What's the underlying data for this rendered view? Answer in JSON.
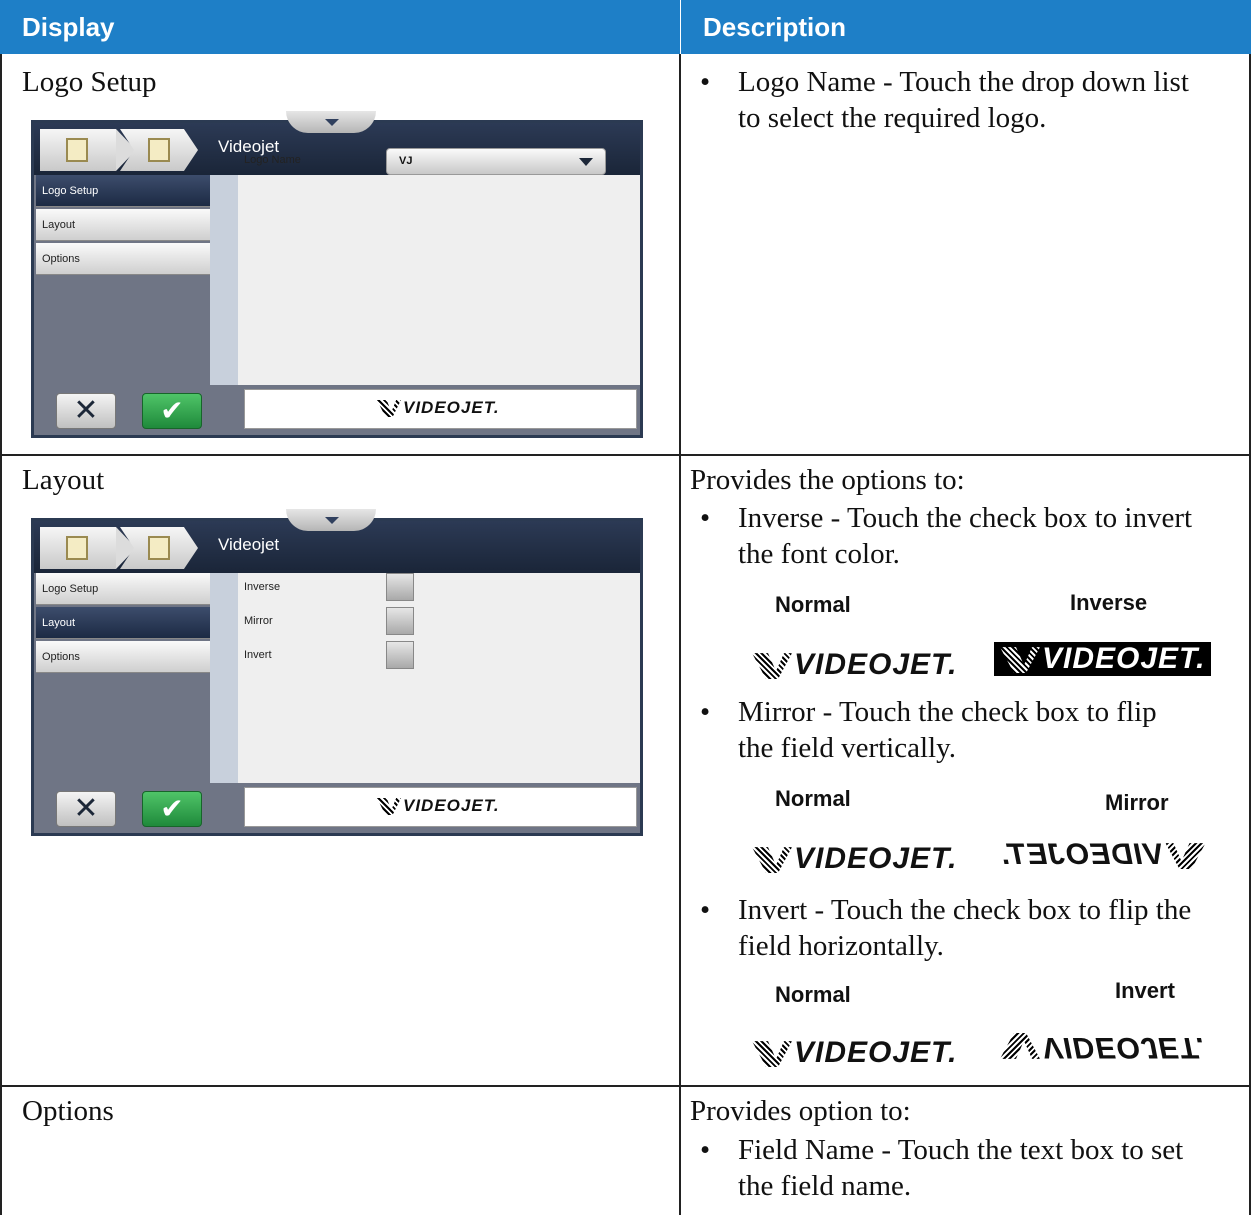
{
  "table": {
    "header_display": "Display",
    "header_description": "Description"
  },
  "rows": [
    {
      "display_title": "Logo Setup",
      "bullets": [
        {
          "text_line1": "Logo Name - Touch the drop down list",
          "text_line2": "to select the required logo."
        }
      ]
    },
    {
      "display_title": "Layout",
      "intro": "Provides the options to:",
      "bullets": [
        {
          "text_line1": "Inverse - Touch the check box to invert",
          "text_line2": "the font color.",
          "left_label": "Normal",
          "right_label": "Inverse"
        },
        {
          "text_line1": "Mirror - Touch the check box to flip",
          "text_line2": "the field vertically.",
          "left_label": "Normal",
          "right_label": "Mirror"
        },
        {
          "text_line1": "Invert - Touch the check box to flip the",
          "text_line2": "field horizontally.",
          "left_label": "Normal",
          "right_label": "Invert"
        }
      ]
    },
    {
      "display_title": "Options",
      "intro": "Provides option to:",
      "bullets": [
        {
          "text_line1": "Field Name - Touch the text box to set",
          "text_line2": "the field name."
        }
      ]
    }
  ],
  "device": {
    "title": "Videojet",
    "menu": [
      "Logo Setup",
      "Layout",
      "Options"
    ],
    "logo_name_label": "Logo Name",
    "logo_name_value": "VJ",
    "checkbox_labels": [
      "Inverse",
      "Mirror",
      "Invert"
    ],
    "cancel_glyph": "✕",
    "ok_glyph": "✔",
    "logo_text": "VIDEOJET."
  },
  "bullet_char": "•",
  "colors": {
    "header_bg": "#1e7fc7",
    "device_dark": "#1c2738",
    "ok_green": "#2aa04a"
  }
}
